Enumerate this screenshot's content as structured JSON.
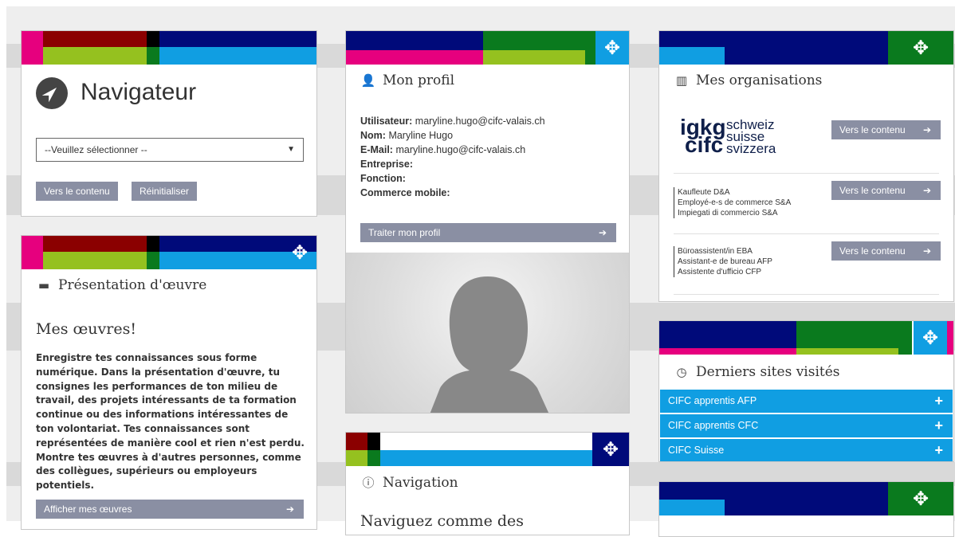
{
  "colors": {
    "magenta": "#e6007e",
    "darkred": "#8b0000",
    "black": "#000000",
    "navy": "#000a7a",
    "green": "#0a7a1e",
    "lime": "#95c11f",
    "cyan": "#109ee2",
    "button": "#8a8fa3"
  },
  "navigator": {
    "title": "Navigateur",
    "select_value": "--Veuillez sélectionner --",
    "btn_content": "Vers le contenu",
    "btn_reset": "Réinitialiser"
  },
  "presentation": {
    "title": "Présentation d'œuvre",
    "subtitle": "Mes œuvres!",
    "description": "Enregistre tes connaissances sous forme numérique. Dans la présentation d'œuvre, tu consignes les performances de ton milieu de travail, des projets intéressants de ta formation continue ou des informations intéressantes de ton volontariat. Tes connaissances sont représentées de manière cool et rien n'est perdu. Montre tes œuvres à d'autres personnes, comme des collègues, supérieurs ou employeurs potentiels.",
    "button": "Afficher mes œuvres"
  },
  "profile": {
    "title": "Mon profil",
    "user_label": "Utilisateur:",
    "user_value": "maryline.hugo@cifc-valais.ch",
    "name_label": "Nom:",
    "name_value": "Maryline Hugo",
    "email_label": "E-Mail:",
    "email_value": "maryline.hugo@cifc-valais.ch",
    "company_label": "Entreprise:",
    "function_label": "Fonction:",
    "mobile_label": "Commerce mobile:",
    "button": "Traiter mon profil"
  },
  "navigation": {
    "title": "Navigation",
    "subtitle": "Naviguez comme des"
  },
  "organisations": {
    "title": "Mes organisations",
    "logo_left_top": "igkg",
    "logo_left_bottom": "cifc",
    "logo_lines": [
      "schweiz",
      "suisse",
      "svizzera"
    ],
    "row2_lines": [
      "Kaufleute D&A",
      "Employé-e-s de commerce S&A",
      "Impiegati di commercio S&A"
    ],
    "row3_lines": [
      "Büroassistent/in EBA",
      "Assistant-e de bureau AFP",
      "Assistente d'ufficio CFP"
    ],
    "button": "Vers le contenu"
  },
  "visited": {
    "title": "Derniers sites visités",
    "items": [
      "CIFC apprentis AFP",
      "CIFC apprentis CFC",
      "CIFC Suisse"
    ]
  },
  "icons": {
    "drag": "move-arrows-icon",
    "arrow": "arrow-right-icon"
  }
}
